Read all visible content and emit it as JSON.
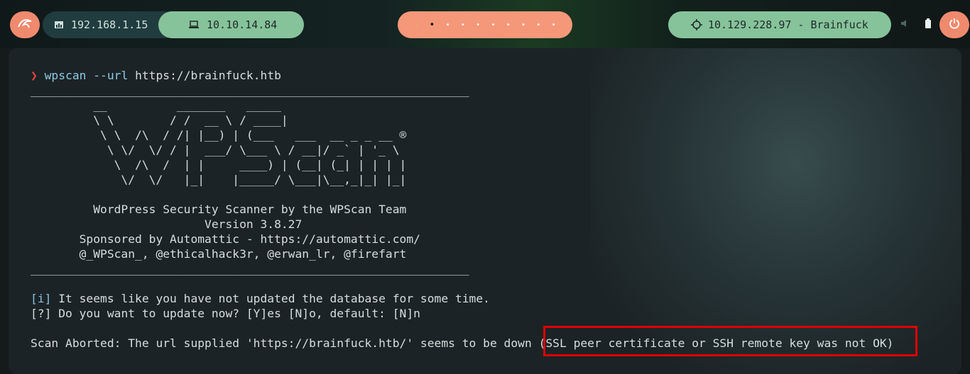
{
  "topbar": {
    "host_ip": "192.168.1.15",
    "vpn_ip": "10.10.14.84",
    "workspaces": [
      "•",
      "•",
      "•",
      "•",
      "•",
      "•",
      "•",
      "•",
      "•",
      "•"
    ],
    "target": "10.129.228.97 - Brainfuck",
    "colors": {
      "accent_orange": "#f08a6f",
      "accent_green": "#86c39a",
      "dark_pill": "#213c3f"
    }
  },
  "terminal": {
    "prompt_symbol": "❯",
    "command": "wpscan --url",
    "command_arg": "https://brainfuck.htb",
    "separator": "_______________________________________________________________",
    "banner": [
      "         __          _______   _____",
      "         \\ \\        / /  __ \\ / ____|",
      "          \\ \\  /\\  / /| |__) | (___   ___  __ _ _ __ ®",
      "           \\ \\/  \\/ / |  ___/ \\___ \\ / __|/ _` | '_ \\",
      "            \\  /\\  /  | |     ____) | (__| (_| | | | |",
      "             \\/  \\/   |_|    |_____/ \\___|\\__,_|_| |_|"
    ],
    "info_lines": [
      "         WordPress Security Scanner by the WPScan Team",
      "                         Version 3.8.27",
      "       Sponsored by Automattic - https://automattic.com/",
      "       @_WPScan_, @ethicalhack3r, @erwan_lr, @firefart"
    ],
    "notice_tag": "[i]",
    "notice_text": " It seems like you have not updated the database for some time.",
    "question_tag": "[?]",
    "question_text": " Do you want to update now? [Y]es [N]o, default: [N]n",
    "abort_text": "Scan Aborted: The url supplied 'https://brainfuck.htb/' seems to be down ",
    "abort_reason": "(SSL peer certificate or SSH remote key was not OK)"
  }
}
